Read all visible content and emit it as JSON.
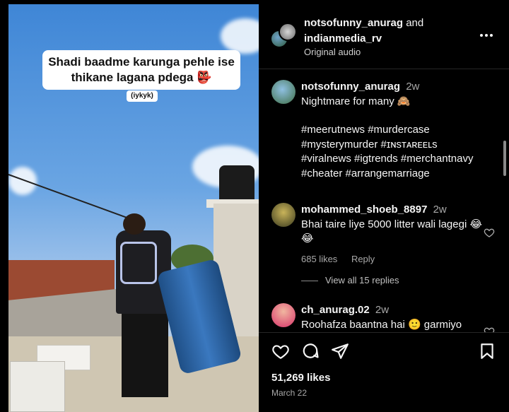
{
  "video": {
    "caption": "Shadi baadme karunga pehle ise thikane lagana pdega 👺",
    "subcaption": "(iykyk)"
  },
  "header": {
    "user1": "notsofunny_anurag",
    "and_text": "and",
    "user2": "indianmedia_rv",
    "audio": "Original audio",
    "more_icon": "more-horizontal-icon"
  },
  "post": {
    "username": "notsofunny_anurag",
    "time": "2w",
    "caption_line": "Nightmare for many 🙈",
    "hashtags_1": "#meerutnews #murdercase",
    "hashtags_2": "#mysterymurder #ɪɴsᴛᴀʀᴇᴇʟs",
    "hashtags_3": "#viralnews #igtrends #merchantnavy",
    "hashtags_4": "#cheater #arrangemarriage"
  },
  "comments": [
    {
      "username": "mohammed_shoeb_8897",
      "time": "2w",
      "text": "Bhai taire liye 5000 litter wali lagegi 😂 😂",
      "likes": "685 likes",
      "reply": "Reply",
      "view_replies": "View all 15 replies"
    },
    {
      "username": "ch_anurag.02",
      "time": "2w",
      "text": "Roohafza baantna hai 🙂 garmiyo"
    }
  ],
  "footer": {
    "likes": "51,269 likes",
    "date": "March 22"
  },
  "colors": {
    "background": "#000000",
    "text": "#f5f5f5",
    "muted": "#a8a8a8"
  }
}
